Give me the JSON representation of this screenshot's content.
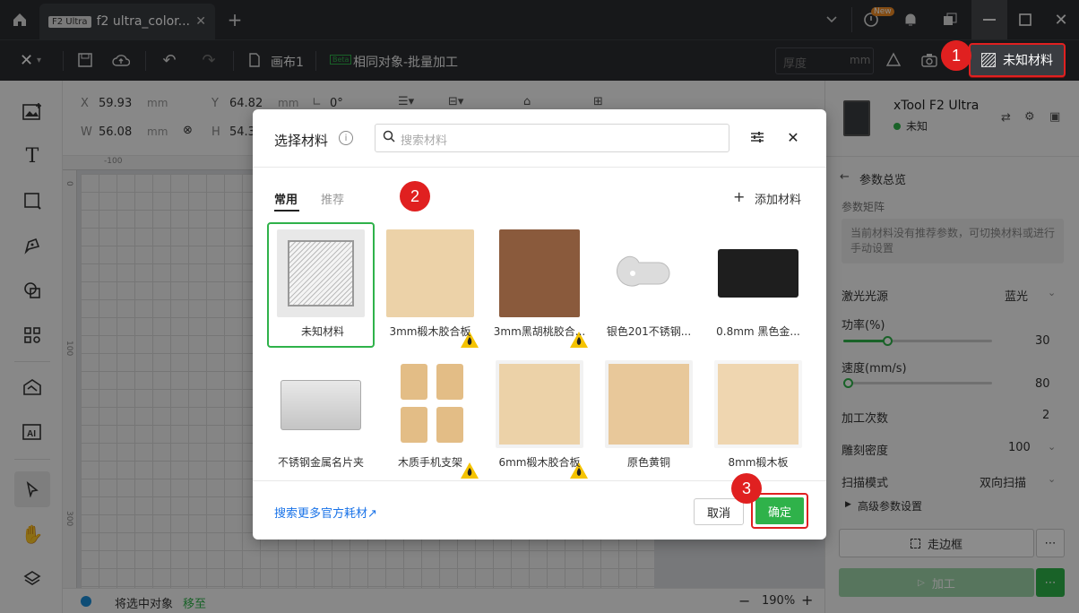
{
  "titlebar": {
    "tab_chip": "F2 Ultra",
    "tab_title": "f2 ultra_color...",
    "new_badge": "New"
  },
  "toolbar": {
    "canvas_name": "画布1",
    "batch_badge": "Beta",
    "batch_label": "相同对象-批量加工",
    "thickness_placeholder": "厚度",
    "thickness_unit": "mm",
    "material_label": "未知材料"
  },
  "props": {
    "x_label": "X",
    "x_value": "59.93",
    "x_unit": "mm",
    "y_label": "Y",
    "y_value": "64.82",
    "y_unit": "mm",
    "angle_value": "0°",
    "w_label": "W",
    "w_value": "56.08",
    "w_unit": "mm",
    "h_label": "H",
    "h_value": "54.3"
  },
  "ruler": {
    "top_tick": "-100",
    "left_ticks": [
      "0",
      "100",
      "300"
    ]
  },
  "statusbar": {
    "text": "将选中对象",
    "link": "移至",
    "zoom": "190%"
  },
  "device": {
    "name": "xTool F2 Ultra",
    "status": "未知"
  },
  "params": {
    "header": "参数总览",
    "matrix_label": "参数矩阵",
    "notice": "当前材料没有推荐参数，可切换材料或进行手动设置",
    "laser_label": "激光光源",
    "laser_value": "蓝光",
    "power_label": "功率(%)",
    "power_value": "30",
    "speed_label": "速度(mm/s)",
    "speed_value": "80",
    "passes_label": "加工次数",
    "passes_value": "2",
    "density_label": "雕刻密度",
    "density_value": "100",
    "scan_label": "扫描模式",
    "scan_value": "双向扫描",
    "advanced_label": "高级参数设置",
    "frame_label": "走边框",
    "process_label": "加工"
  },
  "dialog": {
    "title": "选择材料",
    "search_placeholder": "搜索材料",
    "tabs": [
      "常用",
      "推荐"
    ],
    "add_material": "添加材料",
    "materials": [
      {
        "label": "未知材料",
        "selected": true
      },
      {
        "label": "3mm椴木胶合板",
        "fire": true
      },
      {
        "label": "3mm黑胡桃胶合...",
        "fire": true
      },
      {
        "label": "银色201不锈钢..."
      },
      {
        "label": "0.8mm 黑色金..."
      },
      {
        "label": "不锈钢金属名片夹"
      },
      {
        "label": "木质手机支架",
        "fire": true
      },
      {
        "label": "6mm椴木胶合板",
        "fire": true
      },
      {
        "label": "原色黄铜"
      },
      {
        "label": "8mm椴木板"
      }
    ],
    "more_link": "搜索更多官方耗材↗",
    "cancel": "取消",
    "confirm": "确定"
  },
  "markers": [
    "1",
    "2",
    "3"
  ],
  "colors": {
    "accent": "#2fb24a",
    "marker": "#e02020",
    "titlebar": "#2b2d31"
  }
}
